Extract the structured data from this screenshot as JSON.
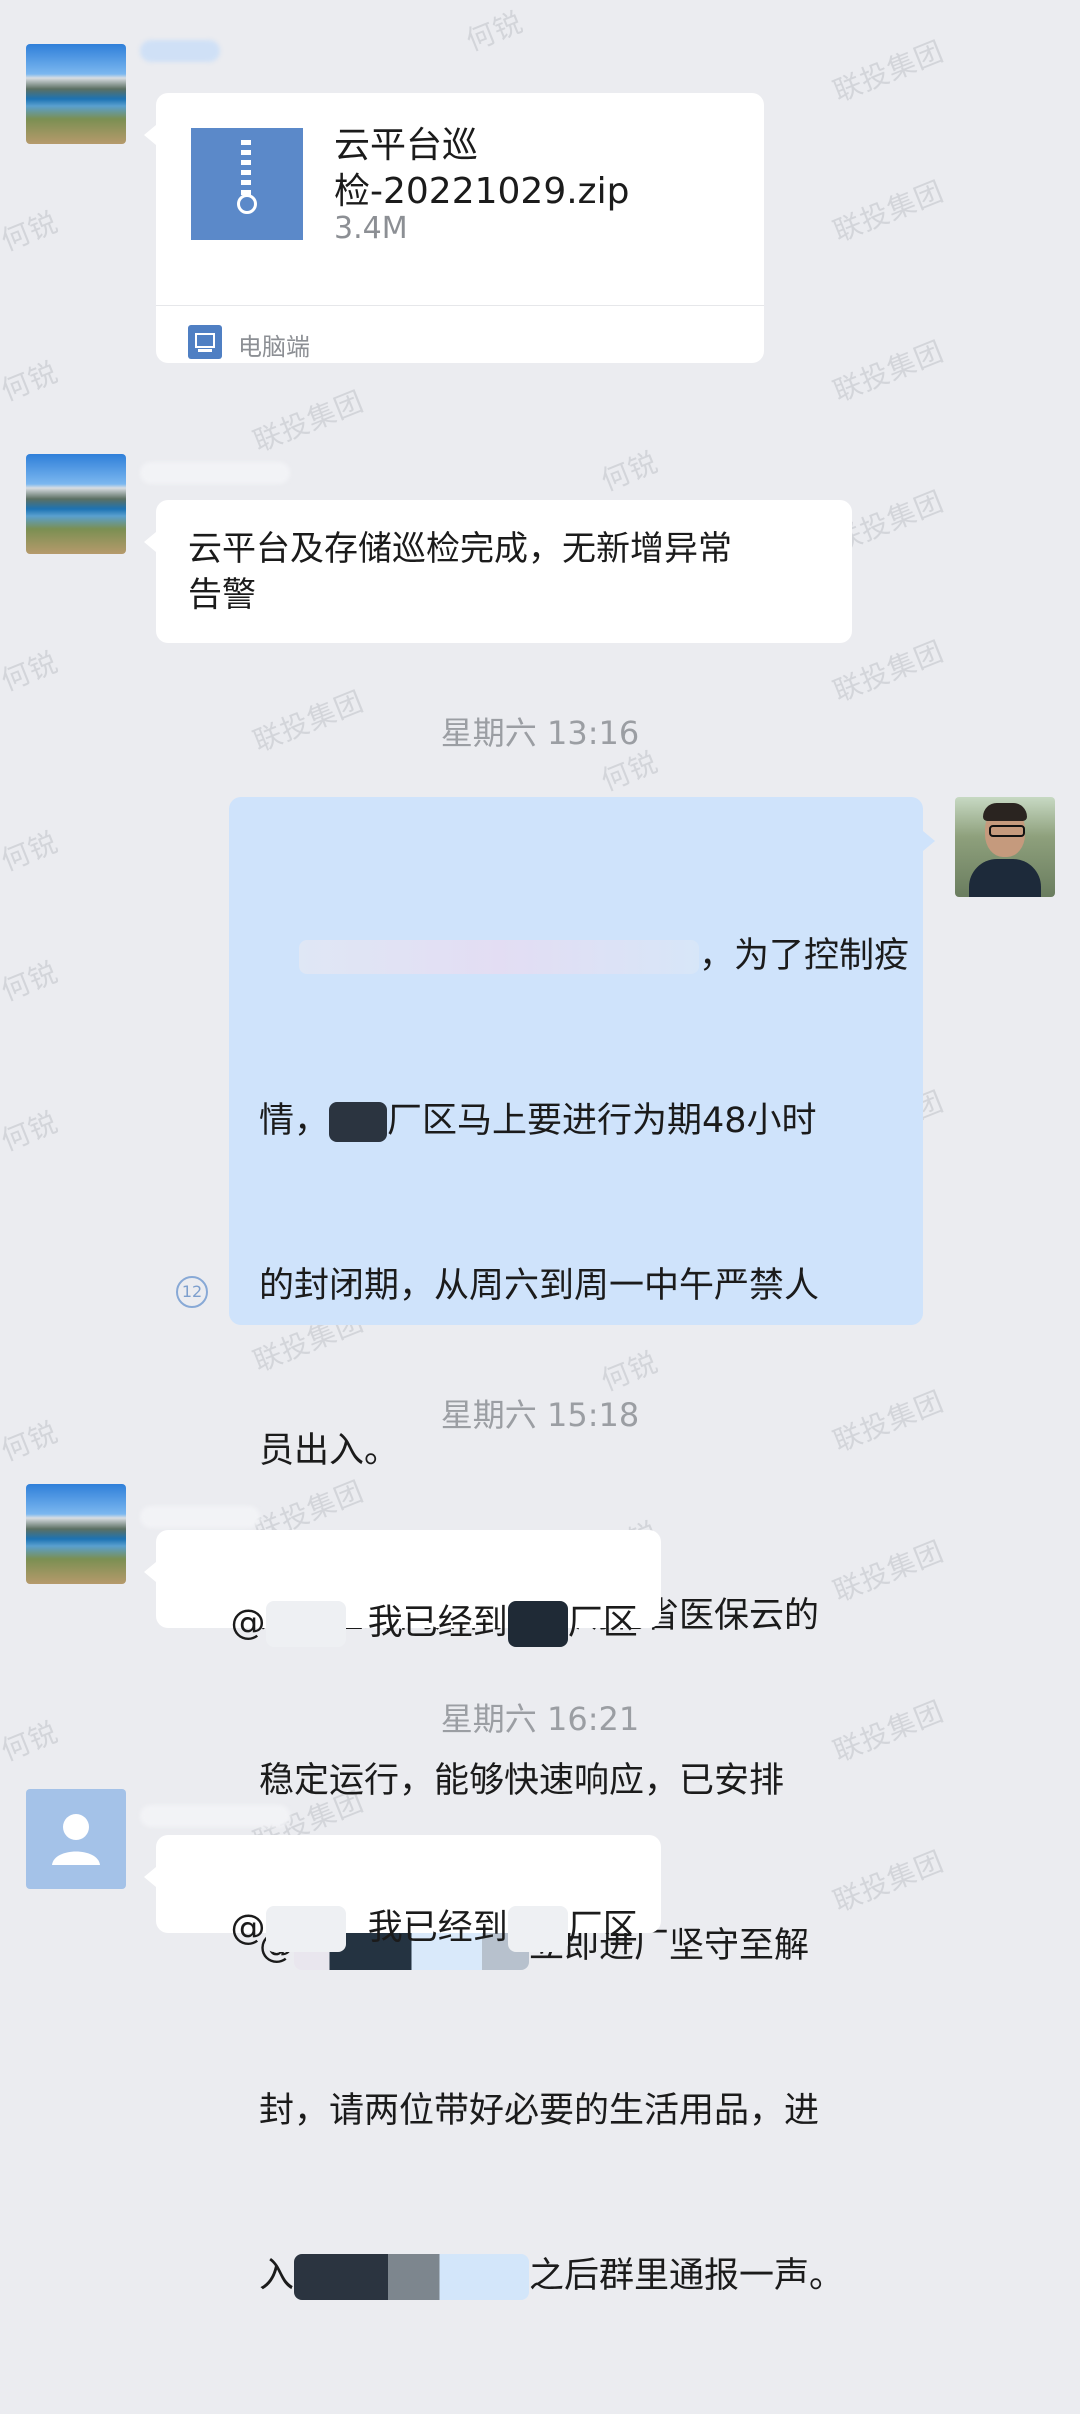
{
  "watermarks": {
    "name": "何锐",
    "org": "联投集团"
  },
  "messages": {
    "file_msg": {
      "file_name": "云平台巡\n检-20221029.zip",
      "file_size": "3.4M",
      "source_label": "电脑端"
    },
    "text_msg_1": {
      "text": "云平台及存储巡检完成，无新增异常\n告警"
    },
    "timestamp_1": "星期六 13:16",
    "text_msg_2": {
      "line1": "，为了控制疫",
      "line2_prefix": "情，",
      "line2_suffix": "厂区马上要进行为期48小时",
      "line3": "的封闭期，从周六到周一中午严禁人",
      "line4": "员出入。",
      "line5": "为了在封闭期间保障湖北省医保云的",
      "line6": "稳定运行，能够快速响应，已安排",
      "line7_prefix": "@",
      "line7_suffix": "立即进厂坚守至解",
      "line8": "封，请两位带好必要的生活用品，进",
      "line9_prefix": "入",
      "line9_suffix": "之后群里通报一声。",
      "read_count": "12"
    },
    "timestamp_2": "星期六 15:18",
    "text_msg_3": {
      "prefix": "@",
      "middle": "我已经到",
      "suffix": "厂区"
    },
    "timestamp_3": "星期六 16:21",
    "text_msg_4": {
      "prefix": "@",
      "middle": "我已经到",
      "suffix": "厂区"
    }
  },
  "colors": {
    "background": "#ebecf0",
    "own_bubble": "#cfe3fb",
    "other_bubble": "#ffffff",
    "timestamp": "#9b9ea3"
  }
}
